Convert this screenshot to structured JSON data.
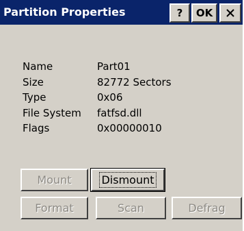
{
  "window": {
    "title": "Partition Properties",
    "help_label": "?",
    "ok_label": "OK",
    "close_icon": "close-icon",
    "colors": {
      "titlebar": "#0a246a",
      "face": "#d4d0c8",
      "title_text": "#ffffff",
      "disabled_text": "#8d8a84"
    }
  },
  "properties": [
    {
      "label": "Name",
      "value": "Part01"
    },
    {
      "label": "Size",
      "value": "82772 Sectors"
    },
    {
      "label": "Type",
      "value": "0x06"
    },
    {
      "label": "File System",
      "value": "fatfsd.dll"
    },
    {
      "label": "Flags",
      "value": "0x00000010"
    }
  ],
  "buttons": {
    "mount": {
      "label": "Mount",
      "enabled": false
    },
    "dismount": {
      "label": "Dismount",
      "enabled": true,
      "focused": true
    },
    "format": {
      "label": "Format",
      "enabled": false
    },
    "scan": {
      "label": "Scan",
      "enabled": false
    },
    "defrag": {
      "label": "Defrag",
      "enabled": false
    }
  }
}
